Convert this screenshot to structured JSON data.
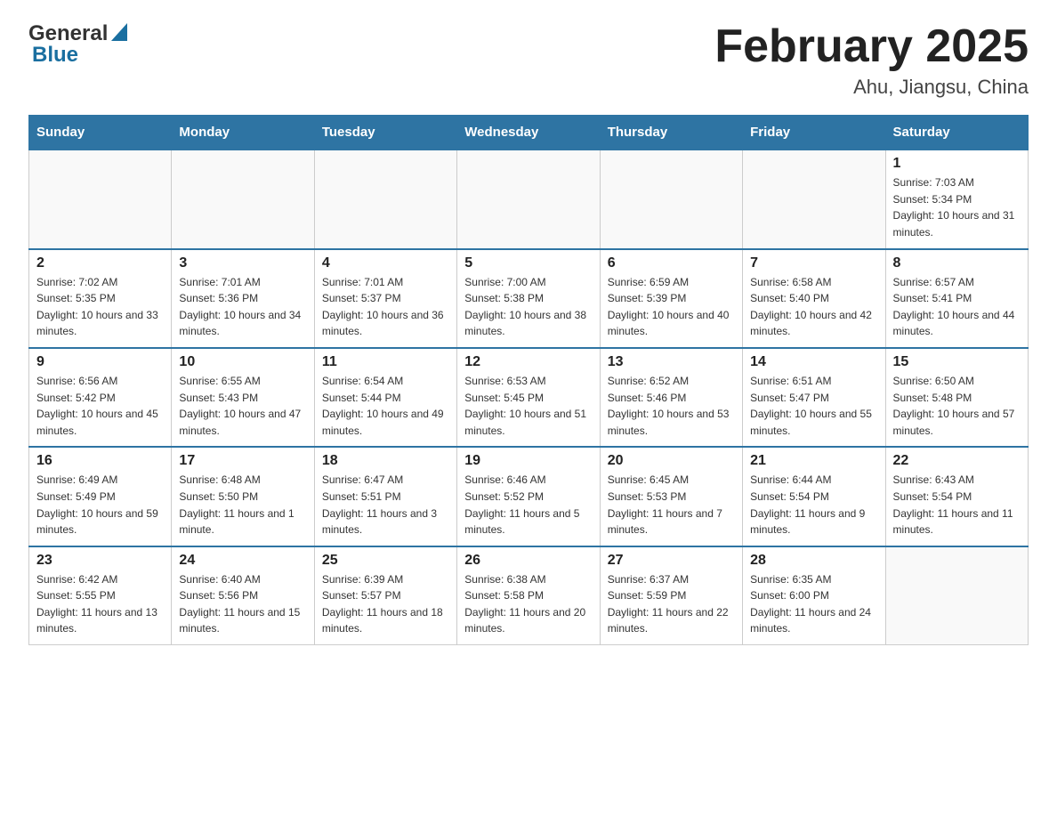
{
  "header": {
    "logo": {
      "text_general": "General",
      "triangle": "▲",
      "text_blue": "Blue"
    },
    "title": "February 2025",
    "location": "Ahu, Jiangsu, China"
  },
  "calendar": {
    "days_of_week": [
      "Sunday",
      "Monday",
      "Tuesday",
      "Wednesday",
      "Thursday",
      "Friday",
      "Saturday"
    ],
    "weeks": [
      [
        {
          "day": "",
          "info": ""
        },
        {
          "day": "",
          "info": ""
        },
        {
          "day": "",
          "info": ""
        },
        {
          "day": "",
          "info": ""
        },
        {
          "day": "",
          "info": ""
        },
        {
          "day": "",
          "info": ""
        },
        {
          "day": "1",
          "info": "Sunrise: 7:03 AM\nSunset: 5:34 PM\nDaylight: 10 hours and 31 minutes."
        }
      ],
      [
        {
          "day": "2",
          "info": "Sunrise: 7:02 AM\nSunset: 5:35 PM\nDaylight: 10 hours and 33 minutes."
        },
        {
          "day": "3",
          "info": "Sunrise: 7:01 AM\nSunset: 5:36 PM\nDaylight: 10 hours and 34 minutes."
        },
        {
          "day": "4",
          "info": "Sunrise: 7:01 AM\nSunset: 5:37 PM\nDaylight: 10 hours and 36 minutes."
        },
        {
          "day": "5",
          "info": "Sunrise: 7:00 AM\nSunset: 5:38 PM\nDaylight: 10 hours and 38 minutes."
        },
        {
          "day": "6",
          "info": "Sunrise: 6:59 AM\nSunset: 5:39 PM\nDaylight: 10 hours and 40 minutes."
        },
        {
          "day": "7",
          "info": "Sunrise: 6:58 AM\nSunset: 5:40 PM\nDaylight: 10 hours and 42 minutes."
        },
        {
          "day": "8",
          "info": "Sunrise: 6:57 AM\nSunset: 5:41 PM\nDaylight: 10 hours and 44 minutes."
        }
      ],
      [
        {
          "day": "9",
          "info": "Sunrise: 6:56 AM\nSunset: 5:42 PM\nDaylight: 10 hours and 45 minutes."
        },
        {
          "day": "10",
          "info": "Sunrise: 6:55 AM\nSunset: 5:43 PM\nDaylight: 10 hours and 47 minutes."
        },
        {
          "day": "11",
          "info": "Sunrise: 6:54 AM\nSunset: 5:44 PM\nDaylight: 10 hours and 49 minutes."
        },
        {
          "day": "12",
          "info": "Sunrise: 6:53 AM\nSunset: 5:45 PM\nDaylight: 10 hours and 51 minutes."
        },
        {
          "day": "13",
          "info": "Sunrise: 6:52 AM\nSunset: 5:46 PM\nDaylight: 10 hours and 53 minutes."
        },
        {
          "day": "14",
          "info": "Sunrise: 6:51 AM\nSunset: 5:47 PM\nDaylight: 10 hours and 55 minutes."
        },
        {
          "day": "15",
          "info": "Sunrise: 6:50 AM\nSunset: 5:48 PM\nDaylight: 10 hours and 57 minutes."
        }
      ],
      [
        {
          "day": "16",
          "info": "Sunrise: 6:49 AM\nSunset: 5:49 PM\nDaylight: 10 hours and 59 minutes."
        },
        {
          "day": "17",
          "info": "Sunrise: 6:48 AM\nSunset: 5:50 PM\nDaylight: 11 hours and 1 minute."
        },
        {
          "day": "18",
          "info": "Sunrise: 6:47 AM\nSunset: 5:51 PM\nDaylight: 11 hours and 3 minutes."
        },
        {
          "day": "19",
          "info": "Sunrise: 6:46 AM\nSunset: 5:52 PM\nDaylight: 11 hours and 5 minutes."
        },
        {
          "day": "20",
          "info": "Sunrise: 6:45 AM\nSunset: 5:53 PM\nDaylight: 11 hours and 7 minutes."
        },
        {
          "day": "21",
          "info": "Sunrise: 6:44 AM\nSunset: 5:54 PM\nDaylight: 11 hours and 9 minutes."
        },
        {
          "day": "22",
          "info": "Sunrise: 6:43 AM\nSunset: 5:54 PM\nDaylight: 11 hours and 11 minutes."
        }
      ],
      [
        {
          "day": "23",
          "info": "Sunrise: 6:42 AM\nSunset: 5:55 PM\nDaylight: 11 hours and 13 minutes."
        },
        {
          "day": "24",
          "info": "Sunrise: 6:40 AM\nSunset: 5:56 PM\nDaylight: 11 hours and 15 minutes."
        },
        {
          "day": "25",
          "info": "Sunrise: 6:39 AM\nSunset: 5:57 PM\nDaylight: 11 hours and 18 minutes."
        },
        {
          "day": "26",
          "info": "Sunrise: 6:38 AM\nSunset: 5:58 PM\nDaylight: 11 hours and 20 minutes."
        },
        {
          "day": "27",
          "info": "Sunrise: 6:37 AM\nSunset: 5:59 PM\nDaylight: 11 hours and 22 minutes."
        },
        {
          "day": "28",
          "info": "Sunrise: 6:35 AM\nSunset: 6:00 PM\nDaylight: 11 hours and 24 minutes."
        },
        {
          "day": "",
          "info": ""
        }
      ]
    ]
  }
}
